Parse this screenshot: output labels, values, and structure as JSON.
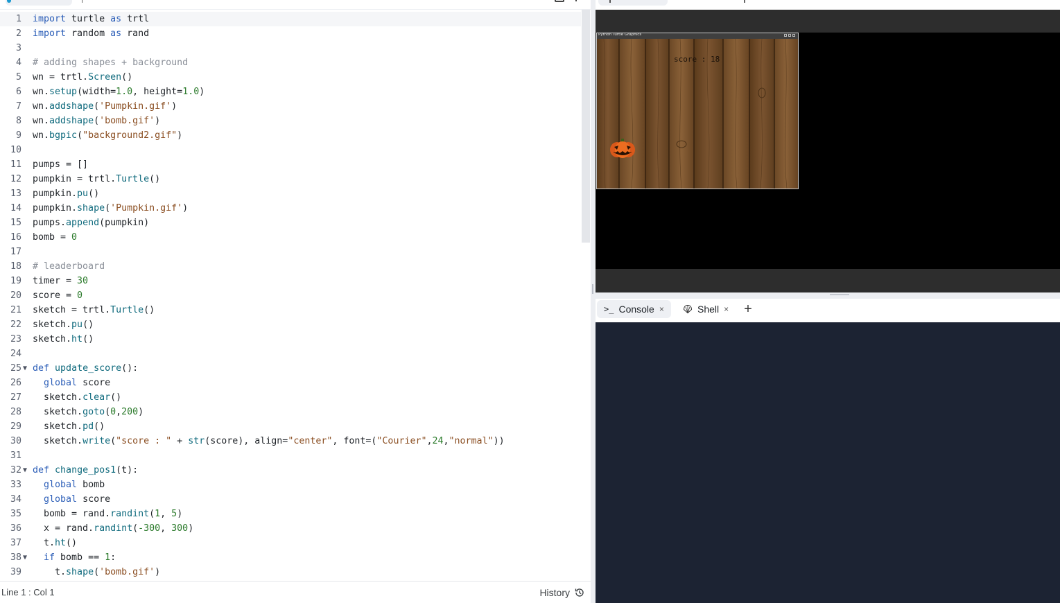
{
  "editor": {
    "lines": [
      {
        "n": "1",
        "html": "<span class=\"kw\">import</span> turtle <span class=\"kw\">as</span> trtl"
      },
      {
        "n": "2",
        "html": "<span class=\"kw\">import</span> random <span class=\"kw\">as</span> rand"
      },
      {
        "n": "3",
        "html": ""
      },
      {
        "n": "4",
        "html": "<span class=\"cm\"># adding shapes + background</span>"
      },
      {
        "n": "5",
        "html": "wn = trtl.<span class=\"fn\">Screen</span>()"
      },
      {
        "n": "6",
        "html": "wn.<span class=\"fn\">setup</span>(width=<span class=\"num\">1.0</span>, height=<span class=\"num\">1.0</span>)"
      },
      {
        "n": "7",
        "html": "wn.<span class=\"fn\">addshape</span>(<span class=\"str\">'Pumpkin.gif'</span>)"
      },
      {
        "n": "8",
        "html": "wn.<span class=\"fn\">addshape</span>(<span class=\"str\">'bomb.gif'</span>)"
      },
      {
        "n": "9",
        "html": "wn.<span class=\"fn\">bgpic</span>(<span class=\"str\">\"background2.gif\"</span>)"
      },
      {
        "n": "10",
        "html": ""
      },
      {
        "n": "11",
        "html": "pumps = []"
      },
      {
        "n": "12",
        "html": "pumpkin = trtl.<span class=\"fn\">Turtle</span>()"
      },
      {
        "n": "13",
        "html": "pumpkin.<span class=\"fn\">pu</span>()"
      },
      {
        "n": "14",
        "html": "pumpkin.<span class=\"fn\">shape</span>(<span class=\"str\">'Pumpkin.gif'</span>)"
      },
      {
        "n": "15",
        "html": "pumps.<span class=\"fn\">append</span>(pumpkin)"
      },
      {
        "n": "16",
        "html": "bomb = <span class=\"num\">0</span>"
      },
      {
        "n": "17",
        "html": ""
      },
      {
        "n": "18",
        "html": "<span class=\"cm\"># leaderboard</span>"
      },
      {
        "n": "19",
        "html": "timer = <span class=\"num\">30</span>"
      },
      {
        "n": "20",
        "html": "score = <span class=\"num\">0</span>"
      },
      {
        "n": "21",
        "html": "sketch = trtl.<span class=\"fn\">Turtle</span>()"
      },
      {
        "n": "22",
        "html": "sketch.<span class=\"fn\">pu</span>()"
      },
      {
        "n": "23",
        "html": "sketch.<span class=\"fn\">ht</span>()"
      },
      {
        "n": "24",
        "html": ""
      },
      {
        "n": "25",
        "fold": true,
        "html": "<span class=\"kw\">def</span> <span class=\"fn\">update_score</span>():"
      },
      {
        "n": "26",
        "html": "  <span class=\"kw\">global</span> score"
      },
      {
        "n": "27",
        "html": "  sketch.<span class=\"fn\">clear</span>()"
      },
      {
        "n": "28",
        "html": "  sketch.<span class=\"fn\">goto</span>(<span class=\"num\">0</span>,<span class=\"num\">200</span>)"
      },
      {
        "n": "29",
        "html": "  sketch.<span class=\"fn\">pd</span>()"
      },
      {
        "n": "30",
        "html": "  sketch.<span class=\"fn\">write</span>(<span class=\"str\">\"score : \"</span> + <span class=\"fn\">str</span>(score), align=<span class=\"str\">\"center\"</span>, font=(<span class=\"str\">\"Courier\"</span>,<span class=\"num\">24</span>,<span class=\"str\">\"normal\"</span>))"
      },
      {
        "n": "31",
        "html": ""
      },
      {
        "n": "32",
        "fold": true,
        "html": "<span class=\"kw\">def</span> <span class=\"fn\">change_pos1</span>(t):"
      },
      {
        "n": "33",
        "html": "  <span class=\"kw\">global</span> bomb"
      },
      {
        "n": "34",
        "html": "  <span class=\"kw\">global</span> score"
      },
      {
        "n": "35",
        "html": "  bomb = rand.<span class=\"fn\">randint</span>(<span class=\"num\">1</span>, <span class=\"num\">5</span>)"
      },
      {
        "n": "36",
        "html": "  x = rand.<span class=\"fn\">randint</span>(<span class=\"num\">-300</span>, <span class=\"num\">300</span>)"
      },
      {
        "n": "37",
        "html": "  t.<span class=\"fn\">ht</span>()"
      },
      {
        "n": "38",
        "fold": true,
        "html": "  <span class=\"kw\">if</span> bomb == <span class=\"num\">1</span>:"
      },
      {
        "n": "39",
        "html": "    t.<span class=\"fn\">shape</span>(<span class=\"str\">'bomb.gif'</span>)"
      }
    ],
    "fold_glyph": "▼"
  },
  "status": {
    "position": "Line 1 : Col 1",
    "history_label": "History"
  },
  "turtle_window": {
    "title": "Python Turtle Graphics",
    "score_text": "score : 18"
  },
  "console": {
    "tabs": [
      {
        "label": "Console",
        "icon": "terminal-prompt-icon",
        "prompt": ">_"
      },
      {
        "label": "Shell",
        "icon": "shell-icon"
      }
    ],
    "close_glyph": "×",
    "add_glyph": "+"
  },
  "colors": {
    "keyword": "#2d5fb8",
    "function": "#0f6a7d",
    "number": "#2a7a2a",
    "string": "#8a4d20",
    "comment": "#8a8f98",
    "console_bg": "#1c2333",
    "wood": "#6b4722",
    "pumpkin": "#e86a1c"
  }
}
